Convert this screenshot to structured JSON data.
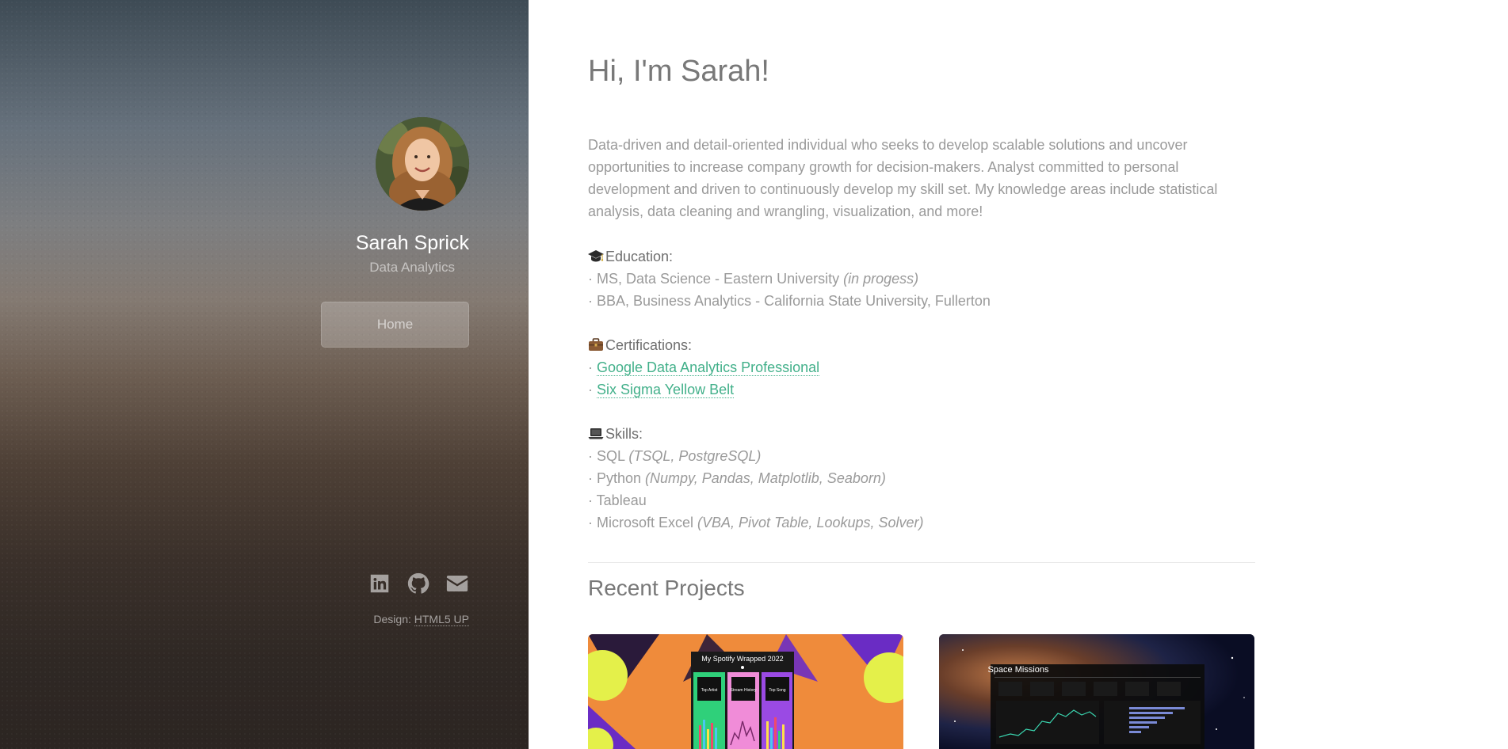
{
  "sidebar": {
    "name": "Sarah Sprick",
    "role": "Data Analytics",
    "nav": {
      "home_label": "Home"
    },
    "socials": [
      {
        "icon": "linkedin-icon"
      },
      {
        "icon": "github-icon"
      },
      {
        "icon": "envelope-icon"
      }
    ],
    "design_credit": {
      "prefix": "Design: ",
      "link_text": "HTML5 UP"
    }
  },
  "main": {
    "greeting": "Hi, I'm Sarah!",
    "intro": "Data-driven and detail-oriented individual who seeks to develop scalable solutions and uncover opportunities to increase company growth for decision-makers. Analyst committed to personal development and driven to continuously develop my skill set. My knowledge areas include statistical analysis, data cleaning and wrangling, visualization, and more!",
    "education": {
      "icon": "graduation-cap-icon",
      "heading": "Education:",
      "items": [
        {
          "text": "· MS, Data Science - Eastern University ",
          "note": "(in progess)"
        },
        {
          "text": "· BBA, Business Analytics - California State University, Fullerton",
          "note": ""
        }
      ]
    },
    "certifications": {
      "icon": "briefcase-icon",
      "heading": "Certifications:",
      "items": [
        {
          "bullet": "· ",
          "link": "Google Data Analytics Professional"
        },
        {
          "bullet": "· ",
          "link": "Six Sigma Yellow Belt"
        }
      ]
    },
    "skills": {
      "icon": "laptop-icon",
      "heading": "Skills:",
      "items": [
        {
          "text": "· SQL ",
          "note": "(TSQL, PostgreSQL)"
        },
        {
          "text": "· Python ",
          "note": "(Numpy, Pandas, Matplotlib, Seaborn)"
        },
        {
          "text": "· Tableau",
          "note": ""
        },
        {
          "text": "· Microsoft Excel ",
          "note": "(VBA, Pivot Table, Lookups, Solver)"
        }
      ]
    },
    "recent_projects": {
      "heading": "Recent Projects",
      "projects": [
        {
          "title": "My Spotify Wrapped 2022",
          "tiles": [
            "Top Artist",
            "Stream History",
            "Top Song"
          ]
        },
        {
          "title": "Space Missions"
        }
      ]
    }
  },
  "colors": {
    "accent_link": "#42b08a",
    "sidebar_top": "#3e4b55",
    "sidebar_bottom": "#2c2522"
  }
}
